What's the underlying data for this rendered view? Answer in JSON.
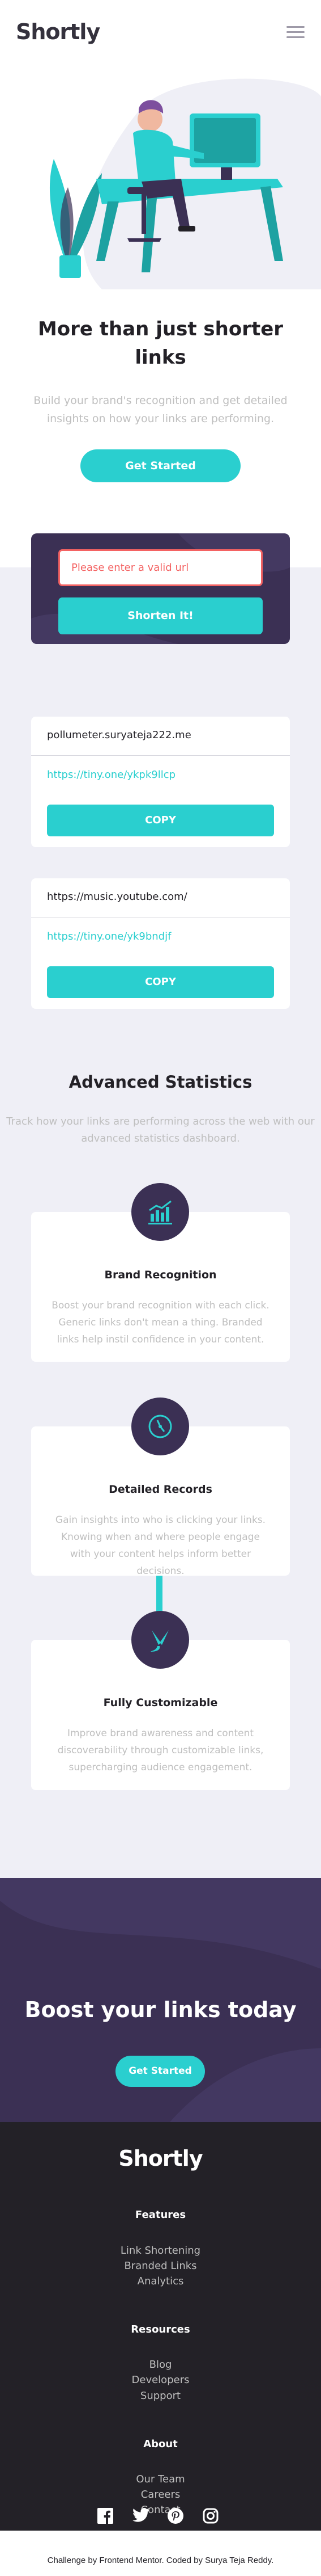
{
  "header": {
    "logo": "Shortly",
    "menu_icon": "hamburger-icon"
  },
  "hero": {
    "title": "More than just shorter links",
    "subtitle": "Build your brand's recognition and get detailed insights on how your links are performing.",
    "cta": "Get Started"
  },
  "shorten": {
    "input_value": "Please enter a valid url",
    "button": "Shorten It!"
  },
  "results": [
    {
      "original": "pollumeter.suryateja222.me",
      "short": "https://tiny.one/ykpk9llcp",
      "copy": "COPY"
    },
    {
      "original": "https://music.youtube.com/",
      "short": "https://tiny.one/yk9bndjf",
      "copy": "COPY"
    }
  ],
  "stats": {
    "title": "Advanced Statistics",
    "subtitle": "Track how your links are performing across the web with our advanced statistics dashboard.",
    "cards": [
      {
        "icon": "bar-chart-icon",
        "title": "Brand Recognition",
        "text": "Boost your brand recognition with each click. Generic links don't mean a thing. Branded links help instil confidence in your content."
      },
      {
        "icon": "gauge-icon",
        "title": "Detailed Records",
        "text": "Gain insights into who is clicking your links. Knowing when and where people engage with your content helps inform better decisions."
      },
      {
        "icon": "pen-brush-icon",
        "title": "Fully Customizable",
        "text": "Improve brand awareness and content discoverability through customizable links, supercharging audience engagement."
      }
    ]
  },
  "boost": {
    "title": "Boost your links today",
    "cta": "Get Started"
  },
  "footer": {
    "logo": "Shortly",
    "columns": [
      {
        "heading": "Features",
        "links": [
          "Link Shortening",
          "Branded Links",
          "Analytics"
        ]
      },
      {
        "heading": "Resources",
        "links": [
          "Blog",
          "Developers",
          "Support"
        ]
      },
      {
        "heading": "About",
        "links": [
          "Our Team",
          "Careers",
          "Contact"
        ]
      }
    ],
    "socials": [
      "facebook-icon",
      "twitter-icon",
      "pinterest-icon",
      "instagram-icon"
    ]
  },
  "attribution": {
    "prefix": "Challenge by ",
    "fm": "Frontend Mentor",
    "middle": ". Coded by ",
    "author": "Surya Teja Reddy",
    "suffix": "."
  },
  "colors": {
    "cyan": "#2acfcf",
    "dark_violet": "#3b3054",
    "red": "#f46262",
    "gray_bg": "#efeff6",
    "footer_bg": "#232127"
  }
}
